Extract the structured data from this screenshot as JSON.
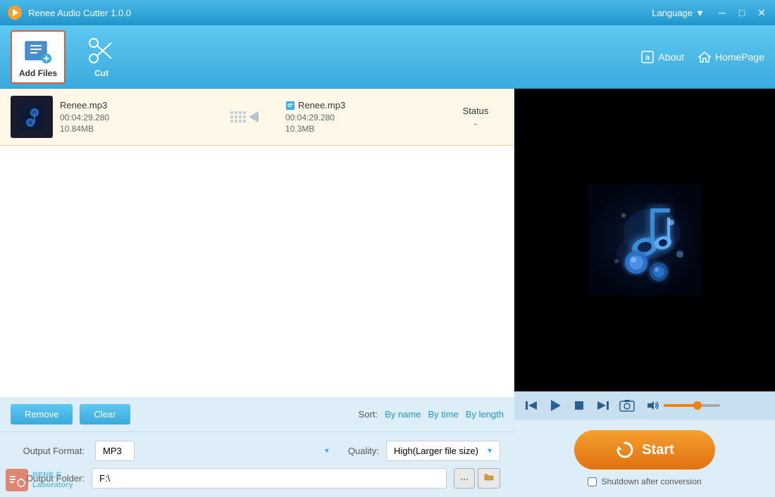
{
  "titleBar": {
    "appName": "Renee Audio Cutter 1.0.0",
    "language": "Language",
    "minimize": "─",
    "maximize": "□",
    "close": "✕"
  },
  "toolbar": {
    "addFilesLabel": "Add Files",
    "cutLabel": "Cut",
    "aboutLabel": "About",
    "homePageLabel": "HomePage"
  },
  "fileList": {
    "items": [
      {
        "inputName": "Renee.mp3",
        "inputDuration": "00:04:29.280",
        "inputSize": "10.84MB",
        "outputName": "Renee.mp3",
        "outputDuration": "00:04:29.280",
        "outputSize": "10.3MB",
        "status": "Status",
        "statusValue": "-"
      }
    ]
  },
  "bottomControls": {
    "removeLabel": "Remove",
    "clearLabel": "Clear",
    "sortLabel": "Sort:",
    "sortByName": "By name",
    "sortByTime": "By time",
    "sortByLength": "By length"
  },
  "settings": {
    "outputFormatLabel": "Output Format:",
    "outputFormatValue": "MP3",
    "qualityLabel": "Quality:",
    "qualityValue": "High(Larger file size)",
    "outputFolderLabel": "Output Folder:",
    "outputFolderPath": "F:\\"
  },
  "player": {
    "playIcon": "▶",
    "stopIcon": "■",
    "prevIcon": "⏮",
    "nextIcon": "⏭",
    "cameraIcon": "📷",
    "volumePercent": 60
  },
  "startArea": {
    "startLabel": "Start",
    "shutdownLabel": "Shutdown after conversion"
  },
  "watermark": {
    "line1": "RENE.E",
    "line2": "Laboratory"
  }
}
